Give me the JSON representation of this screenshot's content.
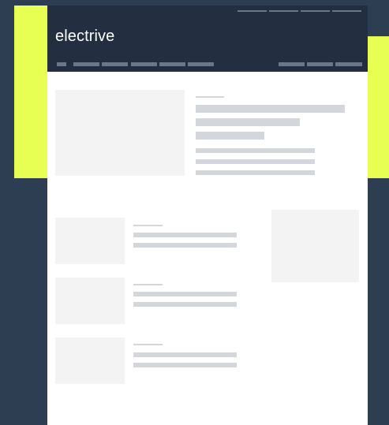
{
  "brand": {
    "name": "electrive",
    "accent": "#e6ff52",
    "header_bg": "#232f40",
    "page_bg": "#2d3e53"
  },
  "header": {
    "utility_links": [
      "",
      "",
      "",
      ""
    ],
    "nav_primary": [
      "",
      "",
      "",
      "",
      "",
      ""
    ],
    "nav_secondary": [
      "",
      "",
      ""
    ]
  },
  "hero": {
    "kicker": "",
    "title_lines": [
      "",
      "",
      ""
    ],
    "excerpt_lines": [
      "",
      "",
      ""
    ]
  },
  "articles": [
    {
      "kicker": "",
      "title_lines": [
        "",
        ""
      ]
    },
    {
      "kicker": "",
      "title_lines": [
        "",
        ""
      ]
    },
    {
      "kicker": "",
      "title_lines": [
        "",
        ""
      ]
    }
  ]
}
